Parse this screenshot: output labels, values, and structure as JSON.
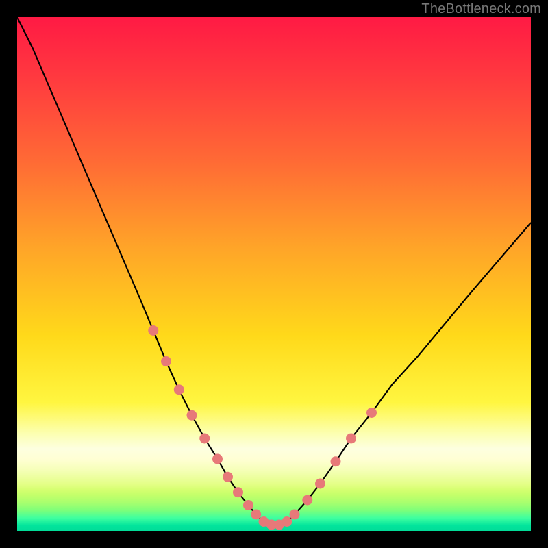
{
  "watermark": "TheBottleneck.com",
  "colors": {
    "frame": "#000000",
    "curve_line": "#000000",
    "marker_fill": "#e77979",
    "marker_stroke": "#e77979"
  },
  "chart_data": {
    "type": "line",
    "title": "",
    "xlabel": "",
    "ylabel": "",
    "xlim": [
      0,
      100
    ],
    "ylim": [
      0,
      100
    ],
    "grid": false,
    "legend": false,
    "x": [
      0,
      3,
      6,
      9,
      12,
      15,
      18,
      21,
      24,
      26.5,
      29,
      31.5,
      34,
      36.5,
      39,
      41,
      43,
      45,
      46.5,
      48,
      49.5,
      51,
      52.5,
      54,
      56.5,
      59,
      62,
      65,
      69,
      73,
      78,
      83,
      88,
      94,
      100
    ],
    "y": [
      100,
      94,
      87,
      80,
      73,
      66,
      59,
      52,
      45,
      39,
      33,
      27.5,
      22.5,
      18,
      14,
      10.5,
      7.5,
      5,
      3.2,
      1.8,
      1.2,
      1.2,
      1.8,
      3.2,
      6,
      9.2,
      13.5,
      18,
      23,
      28.5,
      34,
      40,
      46,
      53,
      60
    ],
    "series": [
      {
        "name": "main-curve",
        "type": "line",
        "stroke_width": 2
      },
      {
        "name": "markers",
        "type": "scatter",
        "marker_radius": 7,
        "points_x": [
          26.5,
          29,
          31.5,
          34,
          36.5,
          39,
          41,
          43,
          45,
          46.5,
          48,
          49.5,
          51,
          52.5,
          54,
          56.5,
          59,
          62,
          65,
          69
        ],
        "points_y": [
          39,
          33,
          27.5,
          22.5,
          18,
          14,
          10.5,
          7.5,
          5,
          3.2,
          1.8,
          1.2,
          1.2,
          1.8,
          3.2,
          6,
          9.2,
          13.5,
          18,
          23
        ]
      }
    ],
    "background": {
      "type": "vertical-gradient",
      "stops": [
        {
          "pos": 0.0,
          "color": "#ff1a44"
        },
        {
          "pos": 0.28,
          "color": "#ff6a35"
        },
        {
          "pos": 0.62,
          "color": "#ffd91a"
        },
        {
          "pos": 0.84,
          "color": "#fdffe0"
        },
        {
          "pos": 0.93,
          "color": "#c4ff6a"
        },
        {
          "pos": 1.0,
          "color": "#01dc98"
        }
      ]
    }
  }
}
